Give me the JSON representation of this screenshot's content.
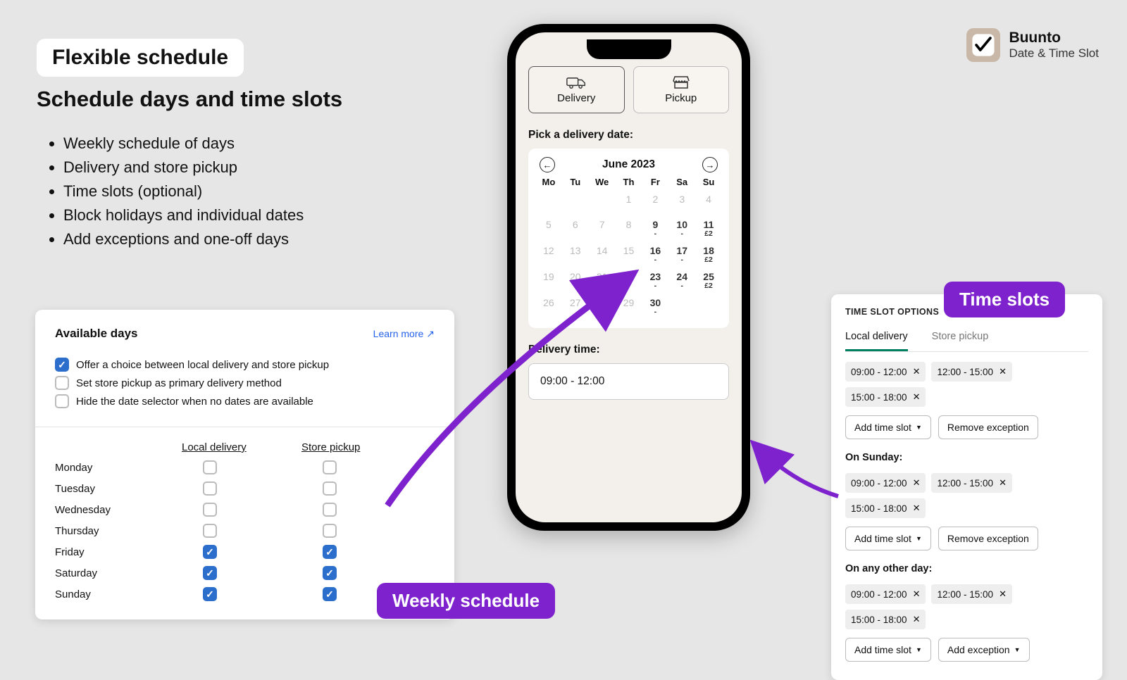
{
  "brand": {
    "name": "Buunto",
    "tagline": "Date & Time Slot"
  },
  "heading": {
    "pill": "Flexible schedule",
    "subtitle": "Schedule days and time slots",
    "bullets": [
      "Weekly schedule of days",
      "Delivery and store pickup",
      "Time slots (optional)",
      "Block holidays and individual dates",
      "Add exceptions and one-off days"
    ]
  },
  "callouts": {
    "weekly": "Weekly schedule",
    "slots": "Time slots"
  },
  "available_days": {
    "title": "Available days",
    "learn_more": "Learn more",
    "options": [
      {
        "label": "Offer a choice between local delivery and store pickup",
        "checked": true
      },
      {
        "label": "Set store pickup as primary delivery method",
        "checked": false
      },
      {
        "label": "Hide the date selector when no dates are available",
        "checked": false
      }
    ],
    "columns": [
      "Local delivery",
      "Store pickup"
    ],
    "rows": [
      {
        "day": "Monday",
        "local": false,
        "pickup": false
      },
      {
        "day": "Tuesday",
        "local": false,
        "pickup": false
      },
      {
        "day": "Wednesday",
        "local": false,
        "pickup": false
      },
      {
        "day": "Thursday",
        "local": false,
        "pickup": false
      },
      {
        "day": "Friday",
        "local": true,
        "pickup": true
      },
      {
        "day": "Saturday",
        "local": true,
        "pickup": true
      },
      {
        "day": "Sunday",
        "local": true,
        "pickup": true
      }
    ]
  },
  "phone": {
    "mode_delivery": "Delivery",
    "mode_pickup": "Pickup",
    "pick_label": "Pick a delivery date:",
    "month": "June 2023",
    "dow": [
      "Mo",
      "Tu",
      "We",
      "Th",
      "Fr",
      "Sa",
      "Su"
    ],
    "weeks": [
      [
        "",
        "",
        "",
        "1",
        "2",
        "3",
        "4"
      ],
      [
        "5",
        "6",
        "7",
        "8",
        "9",
        "10",
        "11"
      ],
      [
        "12",
        "13",
        "14",
        "15",
        "16",
        "17",
        "18"
      ],
      [
        "19",
        "20",
        "21",
        "22",
        "23",
        "24",
        "25"
      ],
      [
        "26",
        "27",
        "28",
        "29",
        "30",
        "",
        ""
      ]
    ],
    "available_days": [
      9,
      10,
      11,
      16,
      17,
      18,
      23,
      24,
      25,
      30
    ],
    "price_days": {
      "11": "£2",
      "18": "£2",
      "25": "£2"
    },
    "delivery_time_label": "Delivery time:",
    "delivery_time_value": "09:00 - 12:00"
  },
  "time_slots": {
    "panel_title": "TIME SLOT OPTIONS",
    "tabs": {
      "active": "Local delivery",
      "other": "Store pickup"
    },
    "add_btn": "Add time slot",
    "remove_btn": "Remove exception",
    "add_exception_btn": "Add exception",
    "groups": [
      {
        "label": "",
        "chips": [
          "09:00 - 12:00",
          "12:00 - 15:00",
          "15:00 - 18:00"
        ],
        "secondary": "remove"
      },
      {
        "label": "On Sunday:",
        "chips": [
          "09:00 - 12:00",
          "12:00 - 15:00",
          "15:00 - 18:00"
        ],
        "secondary": "remove"
      },
      {
        "label": "On any other day:",
        "chips": [
          "09:00 - 12:00",
          "12:00 - 15:00",
          "15:00 - 18:00"
        ],
        "secondary": "add_exception"
      }
    ]
  }
}
